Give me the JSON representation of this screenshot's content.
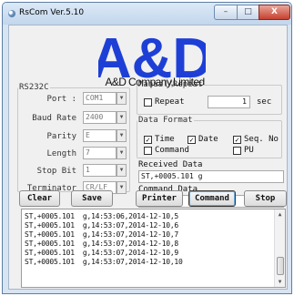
{
  "window": {
    "title": "RsCom Ver.5.10",
    "minimize_glyph": "–",
    "maximize_glyph": "□",
    "close_glyph": "X"
  },
  "logo": {
    "brand_mark": "A&D",
    "company_name": "A&D Company,Limited",
    "brand_color": "#1e3fd6"
  },
  "rs232c": {
    "legend": "RS232C",
    "fields": [
      {
        "label": "Port :",
        "value": "COM1"
      },
      {
        "label": "Baud Rate",
        "value": "2400"
      },
      {
        "label": "Parity",
        "value": "E"
      },
      {
        "label": "Length",
        "value": "7"
      },
      {
        "label": "Stop Bit",
        "value": "1"
      },
      {
        "label": "Terminator",
        "value": "CR/LF"
      }
    ]
  },
  "manual_repeat": {
    "legend": "Manual/Repeat",
    "repeat_label": "Repeat",
    "repeat_checked": false,
    "interval_value": "1",
    "interval_unit": "sec"
  },
  "data_format": {
    "legend": "Data Format",
    "options": [
      {
        "label": "Time",
        "checked": true
      },
      {
        "label": "Date",
        "checked": true
      },
      {
        "label": "Seq. No",
        "checked": true
      },
      {
        "label": "Command",
        "checked": false
      },
      {
        "label": "PU",
        "checked": false
      }
    ]
  },
  "received": {
    "label": "Received Data",
    "value": "ST,+0005.101  g"
  },
  "command": {
    "label": "Command Data",
    "value": "Q"
  },
  "buttons": {
    "clear": "Clear",
    "save": "Save",
    "printer": "Printer",
    "command": "Command",
    "stop": "Stop"
  },
  "log": {
    "lines": [
      "ST,+0005.101  g,14:53:06,2014-12-10,5",
      "ST,+0005.101  g,14:53:07,2014-12-10,6",
      "ST,+0005.101  g,14:53:07,2014-12-10,7",
      "ST,+0005.101  g,14:53:07,2014-12-10,8",
      "ST,+0005.101  g,14:53:07,2014-12-10,9",
      "ST,+0005.101  g,14:53:07,2014-12-10,10"
    ]
  },
  "icons": {
    "checkmark": "✓",
    "dropdown": "▼",
    "scroll_up": "▲",
    "scroll_down": "▼"
  }
}
